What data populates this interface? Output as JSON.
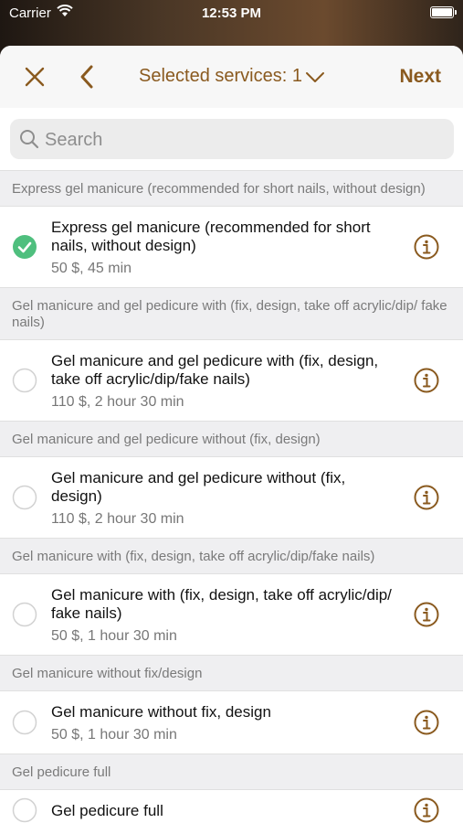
{
  "status_bar": {
    "carrier": "Carrier",
    "time": "12:53 PM"
  },
  "header": {
    "title": "Selected services: 1",
    "next_label": "Next"
  },
  "search": {
    "placeholder": "Search",
    "value": ""
  },
  "colors": {
    "accent": "#8a5a1f",
    "check": "#4fbf7e"
  },
  "sections": [
    {
      "title": "Express gel manicure (recommended for short nails, without design)",
      "items": [
        {
          "name": "Express gel manicure (recommended for short nails, without design)",
          "meta": "50 $,  45 min",
          "selected": true
        }
      ]
    },
    {
      "title": "Gel manicure and gel pedicure with (fix, design, take off acrylic/dip/ fake nails)",
      "items": [
        {
          "name": "Gel manicure and gel pedicure with (fix, design, take off acrylic/dip/fake nails)",
          "meta": "110 $, 2 hour 30 min",
          "selected": false
        }
      ]
    },
    {
      "title": "Gel manicure and gel pedicure without (fix, design)",
      "items": [
        {
          "name": "Gel manicure and gel pedicure without (fix, design)",
          "meta": "110 $, 2 hour 30 min",
          "selected": false
        }
      ]
    },
    {
      "title": "Gel manicure with (fix, design, take off acrylic/dip/fake nails)",
      "items": [
        {
          "name": "Gel manicure with (fix, design, take off acrylic/dip/ fake nails)",
          "meta": "50 $, 1 hour 30 min",
          "selected": false
        }
      ]
    },
    {
      "title": "Gel manicure without fix/design",
      "items": [
        {
          "name": "Gel manicure without fix, design",
          "meta": "50 $, 1 hour 30 min",
          "selected": false
        }
      ]
    },
    {
      "title": "Gel pedicure full",
      "items": [
        {
          "name": "Gel pedicure full",
          "meta": "",
          "selected": false
        }
      ]
    }
  ]
}
